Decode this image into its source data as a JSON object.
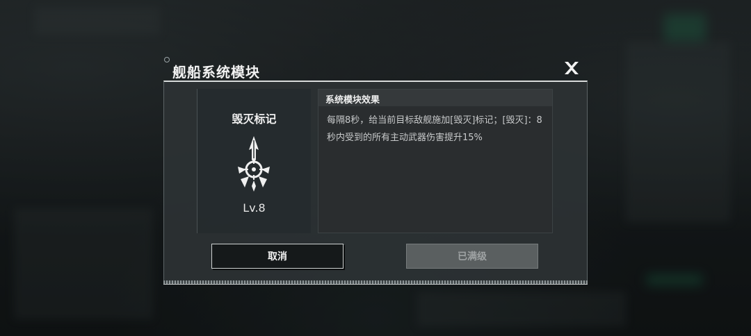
{
  "dialog": {
    "title": "舰船系统模块",
    "close_icon": "close-x-icon"
  },
  "module": {
    "name": "毁灭标记",
    "level": "Lv.8",
    "icon": "crosshair-mark-icon"
  },
  "effect": {
    "heading": "系统模块效果",
    "description": "每隔8秒，给当前目标敌舰施加[毁灭]标记；[毁灭]：8秒内受到的所有主动武器伤害提升15%"
  },
  "buttons": {
    "cancel_label": "取消",
    "max_label": "已满级"
  },
  "colors": {
    "panel_border": "#d9dcdc",
    "button_dark": "#15191a",
    "button_disabled": "#5a5f60"
  }
}
